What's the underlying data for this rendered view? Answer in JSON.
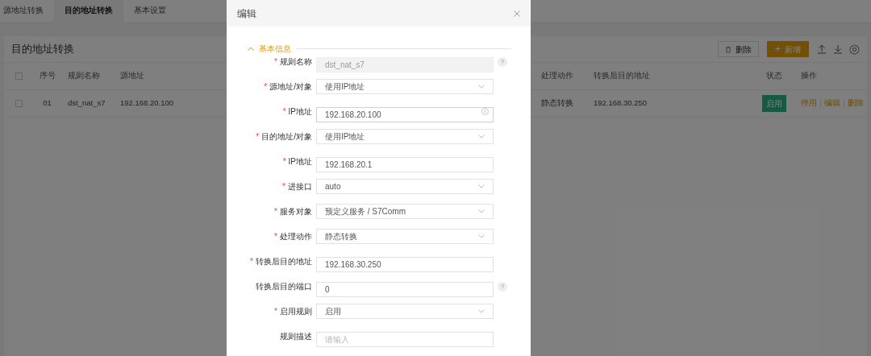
{
  "tabs": [
    {
      "label": "源地址转换",
      "selected": false
    },
    {
      "label": "目的地址转换",
      "selected": true
    },
    {
      "label": "基本设置",
      "selected": false
    }
  ],
  "panel": {
    "title": "目的地址转换",
    "delete_button": "删除",
    "add_icon": "+",
    "add_button": "新增"
  },
  "table": {
    "all_checked": false,
    "columns": [
      "序号",
      "规则名称",
      "源地址",
      "处理动作",
      "转换后目的地址",
      "状态",
      "操作"
    ],
    "rows": [
      {
        "checked": false,
        "cells": [
          "01",
          "dst_nat_s7",
          "192.168.20.100",
          "静态转换",
          "192.168.30.250"
        ],
        "status": "启用",
        "actions": [
          "停用",
          "编辑",
          "删除"
        ]
      }
    ]
  },
  "dialog": {
    "title": "编辑",
    "required_mark": "*",
    "help_mark": "?",
    "section": {
      "title": "基本信息",
      "expanded": true
    },
    "fields": [
      {
        "label": "规则名称",
        "required": true,
        "kind": "readonly",
        "value": "dst_nat_s7",
        "help": true
      },
      {
        "label": "源地址/对象",
        "required": true,
        "kind": "select",
        "value": "使用IP地址"
      },
      {
        "label": "IP地址",
        "required": true,
        "kind": "clearable",
        "value": "192.168.20.100"
      },
      {
        "label": "目的地址/对象",
        "required": true,
        "kind": "select",
        "value": "使用IP地址"
      },
      {
        "label": "IP地址",
        "required": true,
        "kind": "text",
        "value": "192.168.20.1"
      },
      {
        "label": "进接口",
        "required": true,
        "kind": "select",
        "value": "auto"
      },
      {
        "label": "服务对象",
        "required": true,
        "kind": "select",
        "value": "预定义服务 / S7Comm"
      },
      {
        "label": "处理动作",
        "required": true,
        "kind": "select",
        "value": "静态转换"
      },
      {
        "label": "转换后目的地址",
        "required": true,
        "kind": "text",
        "value": "192.168.30.250"
      },
      {
        "label": "转换后目的端口",
        "required": false,
        "kind": "text",
        "value": "0",
        "help": true
      },
      {
        "label": "启用规则",
        "required": true,
        "kind": "select",
        "value": "启用"
      },
      {
        "label": "规则描述",
        "required": false,
        "kind": "text",
        "placeholder": "请输入"
      }
    ]
  }
}
